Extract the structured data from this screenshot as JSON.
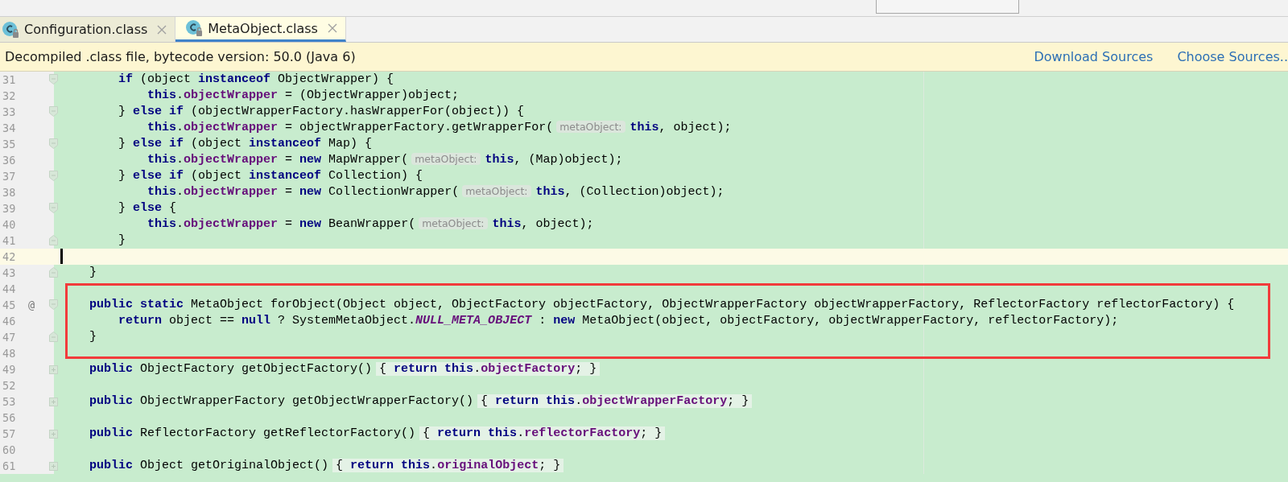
{
  "tabs": [
    {
      "label": "Configuration.class",
      "selected": false
    },
    {
      "label": "MetaObject.class",
      "selected": true
    }
  ],
  "banner": {
    "message": "Decompiled .class file, bytecode version: 50.0 (Java 6)",
    "links": [
      "Download Sources",
      "Choose Sources.."
    ]
  },
  "editor": {
    "lines": [
      {
        "number": "31",
        "kind": "opener",
        "current": false,
        "boxed": false,
        "segments": [
          {
            "kind": "kw",
            "text": "        if"
          },
          {
            "kind": "plain",
            "text": " (object "
          },
          {
            "kind": "kw",
            "text": "instanceof"
          },
          {
            "kind": "plain",
            "text": " ObjectWrapper) {"
          }
        ]
      },
      {
        "number": "32",
        "kind": "plain",
        "current": false,
        "boxed": false,
        "segments": [
          {
            "kind": "kw",
            "text": "            this"
          },
          {
            "kind": "plain",
            "text": "."
          },
          {
            "kind": "field",
            "text": "objectWrapper"
          },
          {
            "kind": "plain",
            "text": " = (ObjectWrapper)object;"
          }
        ]
      },
      {
        "number": "33",
        "kind": "opener",
        "current": false,
        "boxed": false,
        "segments": [
          {
            "kind": "plain",
            "text": "        } "
          },
          {
            "kind": "kw",
            "text": "else if"
          },
          {
            "kind": "plain",
            "text": " (objectWrapperFactory.hasWrapperFor(object)) {"
          }
        ]
      },
      {
        "number": "34",
        "kind": "plain",
        "current": false,
        "boxed": false,
        "segments": [
          {
            "kind": "kw",
            "text": "            this"
          },
          {
            "kind": "plain",
            "text": "."
          },
          {
            "kind": "field",
            "text": "objectWrapper"
          },
          {
            "kind": "plain",
            "text": " = objectWrapperFactory.getWrapperFor("
          },
          {
            "kind": "hint",
            "text": "metaObject:"
          },
          {
            "kind": "kw",
            "text": "this"
          },
          {
            "kind": "plain",
            "text": ", object);"
          }
        ]
      },
      {
        "number": "35",
        "kind": "opener",
        "current": false,
        "boxed": false,
        "segments": [
          {
            "kind": "plain",
            "text": "        } "
          },
          {
            "kind": "kw",
            "text": "else if"
          },
          {
            "kind": "plain",
            "text": " (object "
          },
          {
            "kind": "kw",
            "text": "instanceof"
          },
          {
            "kind": "plain",
            "text": " Map) {"
          }
        ]
      },
      {
        "number": "36",
        "kind": "plain",
        "current": false,
        "boxed": false,
        "segments": [
          {
            "kind": "kw",
            "text": "            this"
          },
          {
            "kind": "plain",
            "text": "."
          },
          {
            "kind": "field",
            "text": "objectWrapper"
          },
          {
            "kind": "plain",
            "text": " = "
          },
          {
            "kind": "kw",
            "text": "new"
          },
          {
            "kind": "plain",
            "text": " MapWrapper("
          },
          {
            "kind": "hint",
            "text": "metaObject:"
          },
          {
            "kind": "kw",
            "text": "this"
          },
          {
            "kind": "plain",
            "text": ", (Map)object);"
          }
        ]
      },
      {
        "number": "37",
        "kind": "opener",
        "current": false,
        "boxed": false,
        "segments": [
          {
            "kind": "plain",
            "text": "        } "
          },
          {
            "kind": "kw",
            "text": "else if"
          },
          {
            "kind": "plain",
            "text": " (object "
          },
          {
            "kind": "kw",
            "text": "instanceof"
          },
          {
            "kind": "plain",
            "text": " Collection) {"
          }
        ]
      },
      {
        "number": "38",
        "kind": "plain",
        "current": false,
        "boxed": false,
        "segments": [
          {
            "kind": "kw",
            "text": "            this"
          },
          {
            "kind": "plain",
            "text": "."
          },
          {
            "kind": "field",
            "text": "objectWrapper"
          },
          {
            "kind": "plain",
            "text": " = "
          },
          {
            "kind": "kw",
            "text": "new"
          },
          {
            "kind": "plain",
            "text": " CollectionWrapper("
          },
          {
            "kind": "hint",
            "text": "metaObject:"
          },
          {
            "kind": "kw",
            "text": "this"
          },
          {
            "kind": "plain",
            "text": ", (Collection)object);"
          }
        ]
      },
      {
        "number": "39",
        "kind": "opener",
        "current": false,
        "boxed": false,
        "segments": [
          {
            "kind": "plain",
            "text": "        } "
          },
          {
            "kind": "kw",
            "text": "else"
          },
          {
            "kind": "plain",
            "text": " {"
          }
        ]
      },
      {
        "number": "40",
        "kind": "plain",
        "current": false,
        "boxed": false,
        "segments": [
          {
            "kind": "kw",
            "text": "            this"
          },
          {
            "kind": "plain",
            "text": "."
          },
          {
            "kind": "field",
            "text": "objectWrapper"
          },
          {
            "kind": "plain",
            "text": " = "
          },
          {
            "kind": "kw",
            "text": "new"
          },
          {
            "kind": "plain",
            "text": " BeanWrapper("
          },
          {
            "kind": "hint",
            "text": "metaObject:"
          },
          {
            "kind": "kw",
            "text": "this"
          },
          {
            "kind": "plain",
            "text": ", object);"
          }
        ]
      },
      {
        "number": "41",
        "kind": "closer",
        "current": false,
        "boxed": false,
        "segments": [
          {
            "kind": "plain",
            "text": "        }"
          }
        ]
      },
      {
        "number": "42",
        "kind": "plain",
        "current": true,
        "boxed": false
      },
      {
        "number": "43",
        "kind": "closer",
        "current": false,
        "boxed": false,
        "segments": [
          {
            "kind": "plain",
            "text": "    }"
          }
        ]
      },
      {
        "number": "44",
        "kind": "plain",
        "current": false,
        "boxed": true
      },
      {
        "number": "45",
        "kind": "opener",
        "current": false,
        "boxed": true,
        "gutter_mark": "@",
        "segments": [
          {
            "kind": "kw",
            "text": "    public static"
          },
          {
            "kind": "plain",
            "text": " MetaObject forObject(Object object, ObjectFactory objectFactory, ObjectWrapperFactory objectWrapperFactory, ReflectorFactory reflectorFactory) {"
          }
        ]
      },
      {
        "number": "46",
        "kind": "plain",
        "current": false,
        "boxed": true,
        "segments": [
          {
            "kind": "kw",
            "text": "        return"
          },
          {
            "kind": "plain",
            "text": " object == "
          },
          {
            "kind": "kw",
            "text": "null"
          },
          {
            "kind": "plain",
            "text": " ? SystemMetaObject."
          },
          {
            "kind": "const",
            "text": "NULL_META_OBJECT"
          },
          {
            "kind": "plain",
            "text": " : "
          },
          {
            "kind": "kw",
            "text": "new"
          },
          {
            "kind": "plain",
            "text": " MetaObject(object, objectFactory, objectWrapperFactory, reflectorFactory);"
          }
        ]
      },
      {
        "number": "47",
        "kind": "closer",
        "current": false,
        "boxed": true,
        "segments": [
          {
            "kind": "plain",
            "text": "    }"
          }
        ]
      },
      {
        "number": "48",
        "kind": "plain",
        "current": false,
        "boxed": true
      },
      {
        "number": "49",
        "kind": "collapsed",
        "current": false,
        "boxed": false,
        "segments": [
          {
            "kind": "kw",
            "text": "    public"
          },
          {
            "kind": "plain",
            "text": " ObjectFactory getObjectFactory() "
          },
          {
            "kind": "folded_open",
            "text": "{ "
          },
          {
            "kind": "folded_kw",
            "text": "return this"
          },
          {
            "kind": "folded",
            "text": "."
          },
          {
            "kind": "folded_field",
            "text": "objectFactory"
          },
          {
            "kind": "folded_close",
            "text": "; }"
          }
        ]
      },
      {
        "number": "52",
        "kind": "plain",
        "current": false,
        "boxed": false
      },
      {
        "number": "53",
        "kind": "collapsed",
        "current": false,
        "boxed": false,
        "segments": [
          {
            "kind": "kw",
            "text": "    public"
          },
          {
            "kind": "plain",
            "text": " ObjectWrapperFactory getObjectWrapperFactory() "
          },
          {
            "kind": "folded_open",
            "text": "{ "
          },
          {
            "kind": "folded_kw",
            "text": "return this"
          },
          {
            "kind": "folded",
            "text": "."
          },
          {
            "kind": "folded_field",
            "text": "objectWrapperFactory"
          },
          {
            "kind": "folded_close",
            "text": "; }"
          }
        ]
      },
      {
        "number": "56",
        "kind": "plain",
        "current": false,
        "boxed": false
      },
      {
        "number": "57",
        "kind": "collapsed",
        "current": false,
        "boxed": false,
        "segments": [
          {
            "kind": "kw",
            "text": "    public"
          },
          {
            "kind": "plain",
            "text": " ReflectorFactory getReflectorFactory() "
          },
          {
            "kind": "folded_open",
            "text": "{ "
          },
          {
            "kind": "folded_kw",
            "text": "return this"
          },
          {
            "kind": "folded",
            "text": "."
          },
          {
            "kind": "folded_field",
            "text": "reflectorFactory"
          },
          {
            "kind": "folded_close",
            "text": "; }"
          }
        ]
      },
      {
        "number": "60",
        "kind": "plain",
        "current": false,
        "boxed": false
      },
      {
        "number": "61",
        "kind": "collapsed",
        "current": false,
        "boxed": false,
        "segments": [
          {
            "kind": "kw",
            "text": "    public"
          },
          {
            "kind": "plain",
            "text": " Object getOriginalObject() "
          },
          {
            "kind": "folded_open",
            "text": "{ "
          },
          {
            "kind": "folded_kw",
            "text": "return this"
          },
          {
            "kind": "folded",
            "text": "."
          },
          {
            "kind": "folded_field",
            "text": "originalObject"
          },
          {
            "kind": "folded_close",
            "text": "; }"
          }
        ]
      }
    ]
  }
}
